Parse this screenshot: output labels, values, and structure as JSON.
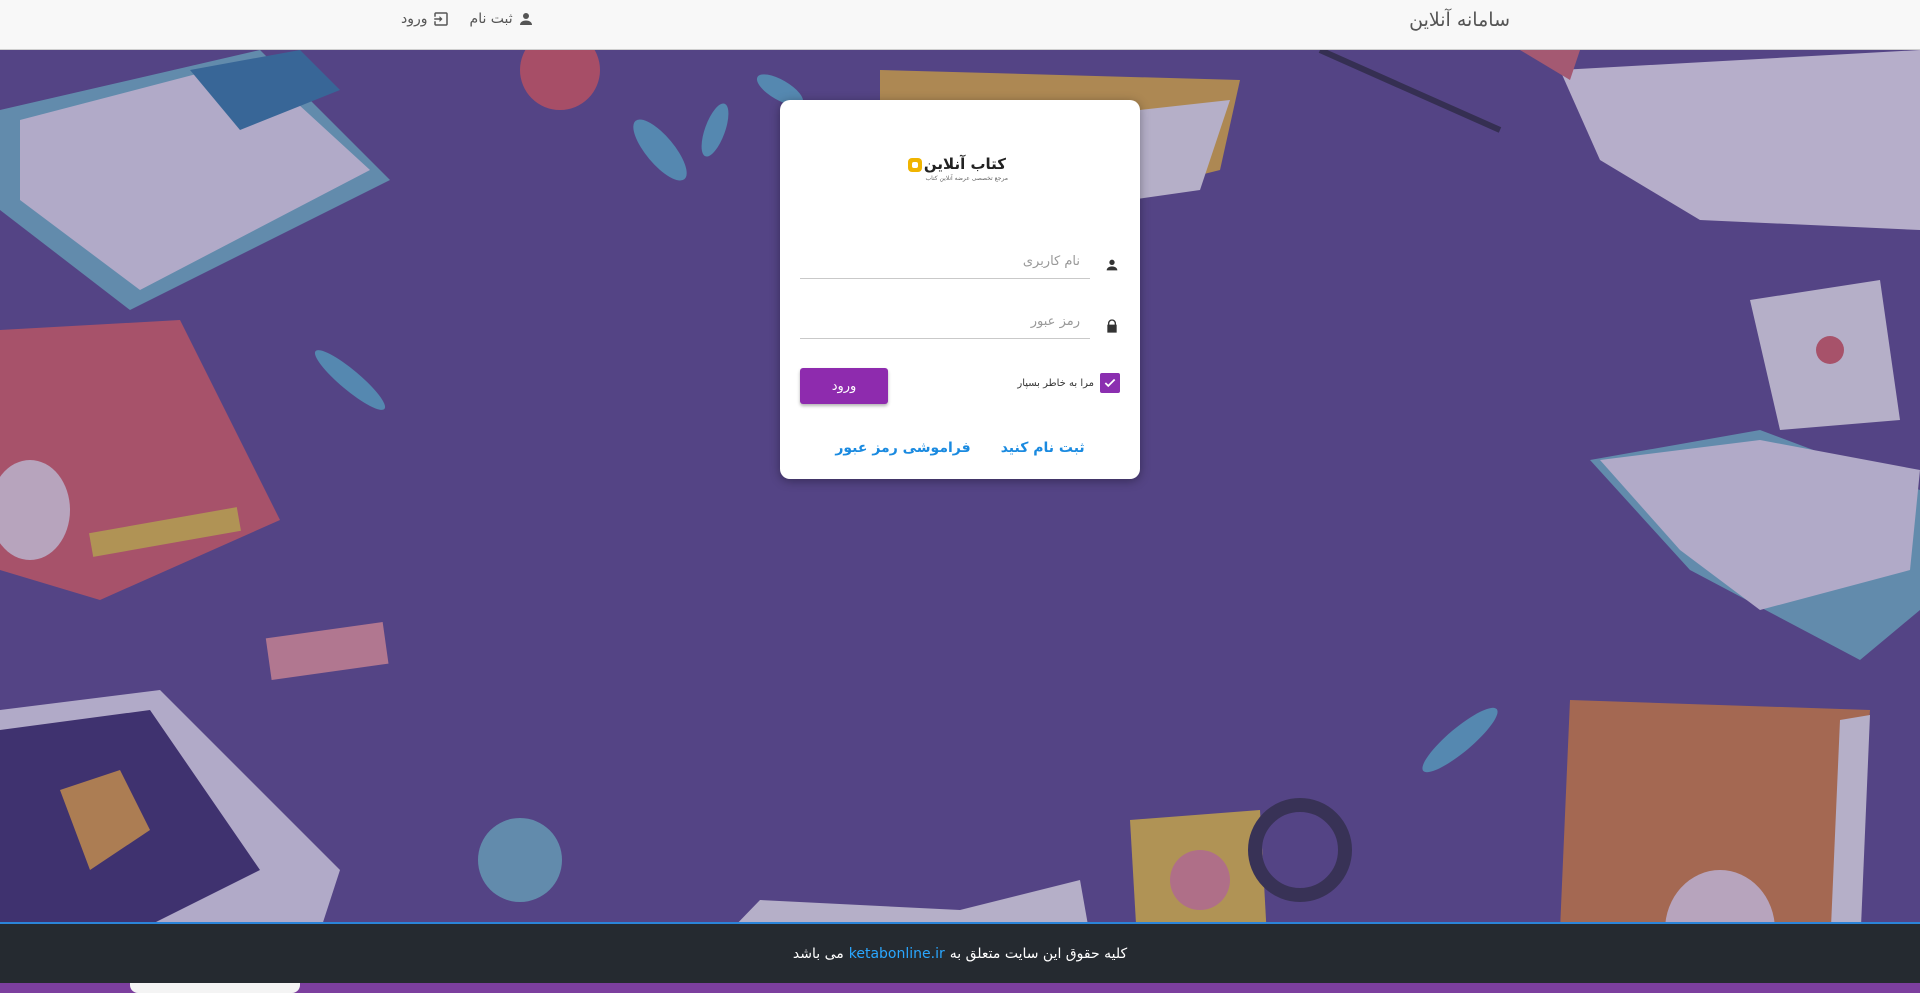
{
  "header": {
    "brand": "سامانه آنلاین",
    "nav": [
      {
        "label": "ثبت نام",
        "icon": "person-icon"
      },
      {
        "label": "ورود",
        "icon": "login-icon"
      }
    ]
  },
  "logo": {
    "title": "کتاب آنلاین",
    "subtitle": "مرجع تخصصی عرضه آنلاین کتاب"
  },
  "login": {
    "username_placeholder": "نام کاربری",
    "password_placeholder": "رمز عبور",
    "remember_label": "مرا به خاطر بسپار",
    "remember_checked": true,
    "submit_label": "ورود",
    "register_link": "ثبت نام کنید",
    "forgot_link": "فراموشی رمز عبور"
  },
  "footer": {
    "text_before": "کلیه حقوق این سایت متعلق به",
    "link": "ketabonline.ir",
    "text_after": "می باشد"
  },
  "colors": {
    "background": "#5a4a87",
    "primary_button": "#8e2bae",
    "link": "#1a8ae0",
    "footer_bg": "#252a30",
    "footer_link": "#2aa7ff"
  }
}
